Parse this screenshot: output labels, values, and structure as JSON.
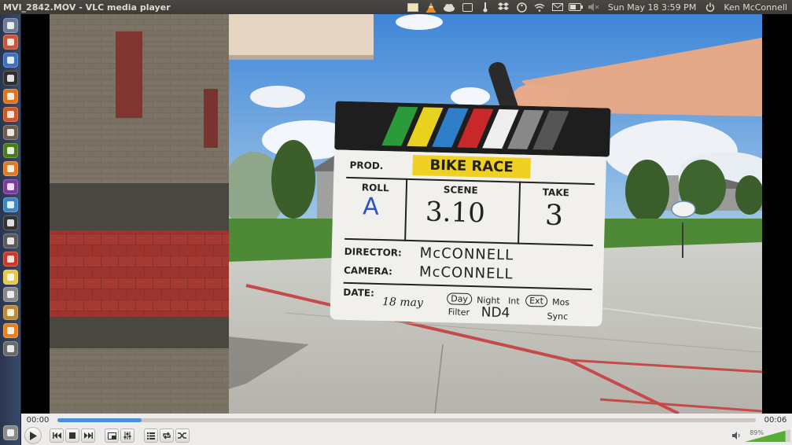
{
  "window": {
    "title": "MVI_2842.MOV - VLC media player"
  },
  "panel": {
    "icons": [
      "notes-icon",
      "vlc-cone-icon",
      "cloud-icon",
      "edit-icon",
      "thermometer-icon",
      "dropbox-icon",
      "accessibility-icon",
      "wifi-icon",
      "mail-icon",
      "battery-icon",
      "volume-muted-icon"
    ],
    "datetime": "Sun May 18  3:59 PM",
    "user": "Ken McConnell"
  },
  "launcher": {
    "items": [
      {
        "name": "dash-icon",
        "color": "#6b7a95"
      },
      {
        "name": "files-icon",
        "color": "#c8553a"
      },
      {
        "name": "firefox-icon",
        "color": "#3b73c2"
      },
      {
        "name": "terminal-icon",
        "color": "#2e2e2e"
      },
      {
        "name": "software-center-icon",
        "color": "#e0741e"
      },
      {
        "name": "settings-icon",
        "color": "#d15826"
      },
      {
        "name": "gimp-icon",
        "color": "#6b5d4b"
      },
      {
        "name": "inkscape-icon",
        "color": "#4a7a1c"
      },
      {
        "name": "blender-icon",
        "color": "#e07a1e"
      },
      {
        "name": "app-purple-icon",
        "color": "#7a3aa0"
      },
      {
        "name": "browser-icon",
        "color": "#3a86c8"
      },
      {
        "name": "video-editor-icon",
        "color": "#333333"
      },
      {
        "name": "monitor-icon",
        "color": "#5a5a5a"
      },
      {
        "name": "chrome-icon",
        "color": "#c93a2e"
      },
      {
        "name": "notes-app-icon",
        "color": "#e8c64a"
      },
      {
        "name": "tools-icon",
        "color": "#888888"
      },
      {
        "name": "archive-icon",
        "color": "#b88a3a"
      },
      {
        "name": "vlc-launcher-icon",
        "color": "#e8801e"
      },
      {
        "name": "usb-icon",
        "color": "#6a6a6a"
      },
      {
        "name": "trash-icon",
        "color": "#8a8a8a"
      }
    ]
  },
  "slate": {
    "prod_label": "PROD.",
    "prod_title": "BIKE RACE",
    "roll_label": "ROLL",
    "roll_value": "A",
    "scene_label": "SCENE",
    "scene_value": "3.10",
    "take_label": "TAKE",
    "take_value": "3",
    "director_label": "DIRECTOR:",
    "director_value": "McCONNELL",
    "camera_label": "CAMERA:",
    "camera_value": "McCONNELL",
    "date_label": "DATE:",
    "date_value": "18 may",
    "day": "Day",
    "night": "Night",
    "int": "Int",
    "ext": "Ext",
    "mos": "Mos",
    "filter_label": "Filter",
    "filter_value": "ND4",
    "sync": "Sync"
  },
  "player": {
    "time_elapsed": "00:00",
    "time_total": "00:06",
    "progress": 0.12,
    "volume_label": "89%",
    "volume": 0.89
  }
}
